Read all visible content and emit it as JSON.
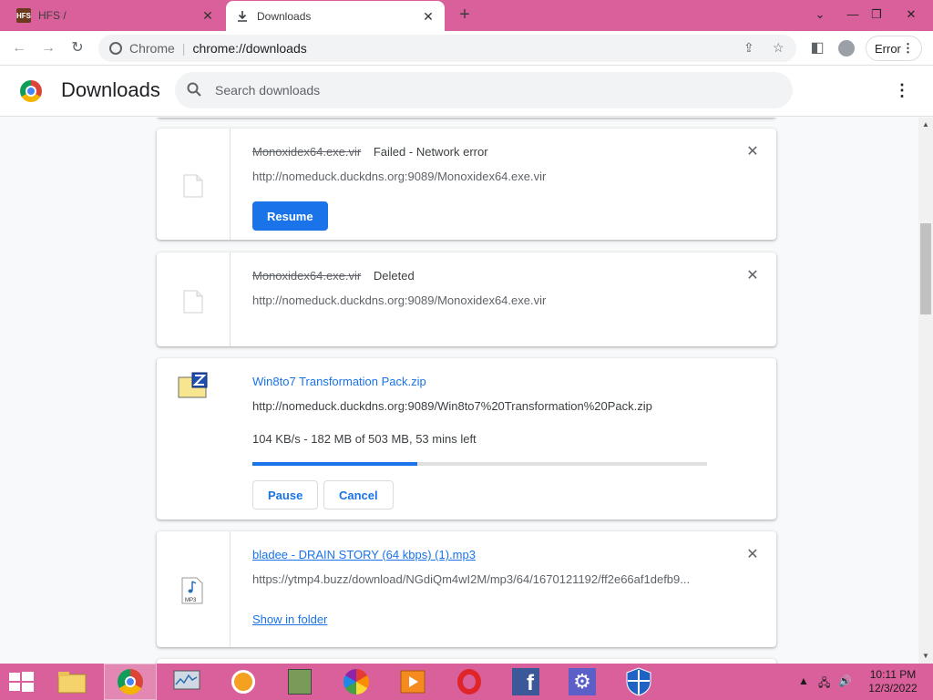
{
  "browser": {
    "tabs": [
      {
        "title": "HFS /",
        "favicon": "hfs-icon",
        "active": false
      },
      {
        "title": "Downloads",
        "favicon": "download-icon",
        "active": true
      }
    ],
    "omnibox": {
      "site_label": "Chrome",
      "url": "chrome://downloads"
    },
    "profile_status": "Error"
  },
  "page": {
    "title": "Downloads",
    "search_placeholder": "Search downloads"
  },
  "downloads": [
    {
      "name": "Monoxidex64.exe.vir",
      "status": "Failed - Network error",
      "url": "http://nomeduck.duckdns.org:9089/Monoxidex64.exe.vir",
      "action": "Resume"
    },
    {
      "name": "Monoxidex64.exe.vir",
      "status": "Deleted",
      "url": "http://nomeduck.duckdns.org:9089/Monoxidex64.exe.vir"
    },
    {
      "name": "Win8to7 Transformation Pack.zip",
      "url": "http://nomeduck.duckdns.org:9089/Win8to7%20Transformation%20Pack.zip",
      "progress_text": "104 KB/s - 182 MB of 503 MB, 53 mins left",
      "progress_fraction": 0.362,
      "pause_label": "Pause",
      "cancel_label": "Cancel"
    },
    {
      "name": "bladee - DRAIN STORY (64 kbps) (1).mp3",
      "url": "https://ytmp4.buzz/download/NGdiQm4wI2M/mp3/64/1670121192/ff2e66af1defb9...",
      "link_label": "Show in folder"
    }
  ],
  "taskbar": {
    "clock_time": "10:11 PM",
    "clock_date": "12/3/2022"
  },
  "colors": {
    "accent": "#1a73e8",
    "titlebar": "#d9609a",
    "taskbar": "#d9609a"
  }
}
